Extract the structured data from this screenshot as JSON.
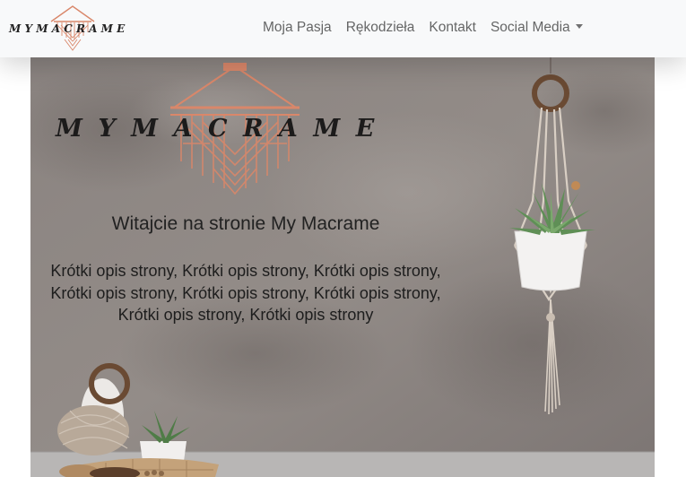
{
  "navbar": {
    "brand_text": "MYMACRAME",
    "items": [
      {
        "label": "Moja Pasja"
      },
      {
        "label": "Rękodzieła"
      },
      {
        "label": "Kontakt"
      },
      {
        "label": "Social Media",
        "has_dropdown": true
      }
    ]
  },
  "hero": {
    "logo_text": "MYMACRAME",
    "title": "Witajcie na stronie My Macrame",
    "description": "Krótki opis strony, Krótki opis strony, Krótki opis strony, Krótki opis strony, Krótki opis strony, Krótki opis strony, Krótki opis strony, Krótki opis strony"
  },
  "colors": {
    "navbar_bg": "#f8f9fa",
    "nav_link": "#6c6c6c",
    "logo_accent": "#d9876a",
    "wall": "#8c8582",
    "floor": "#b9b7b6"
  }
}
